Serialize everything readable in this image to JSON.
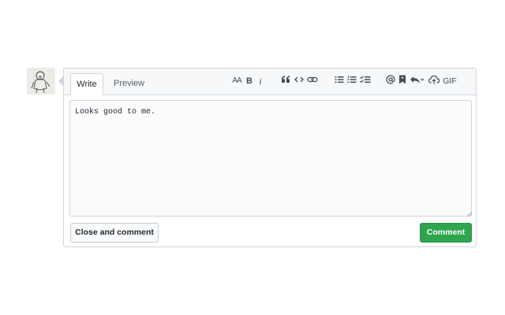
{
  "tabs": {
    "write": "Write",
    "preview": "Preview"
  },
  "toolbar": {
    "heading": "AA",
    "bold": "B",
    "italic": "i",
    "gif": "GIF"
  },
  "editor": {
    "value": "Looks good to me."
  },
  "buttons": {
    "close_and_comment": "Close and comment",
    "comment": "Comment"
  },
  "colors": {
    "accent": "#2ea44f",
    "border": "#d1d5da",
    "header_bg": "#f6f8fa"
  }
}
